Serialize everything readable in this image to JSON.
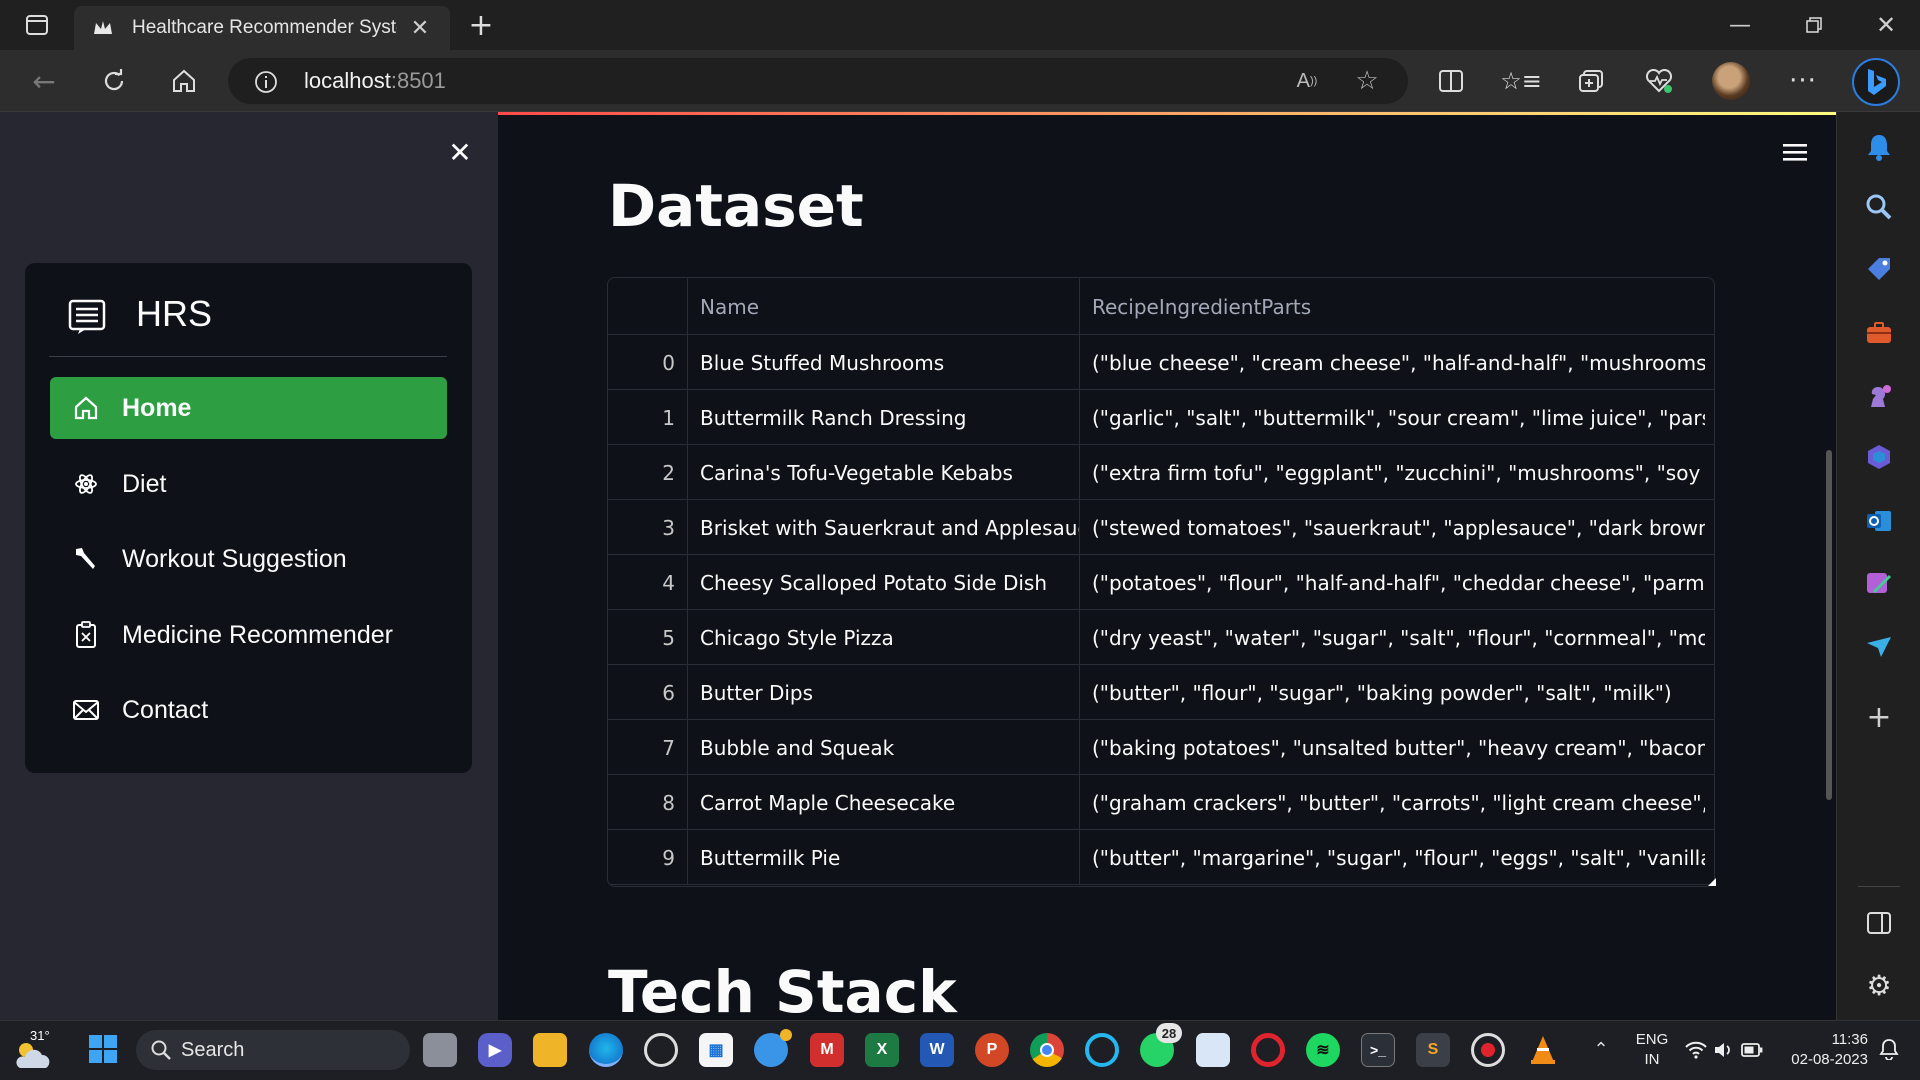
{
  "browser": {
    "tab_title": "Healthcare Recommender Systen",
    "url_host": "localhost",
    "url_port": ":8501"
  },
  "sidebar": {
    "brand": "HRS",
    "items": [
      {
        "label": "Home",
        "icon": "house-icon",
        "active": true
      },
      {
        "label": "Diet",
        "icon": "atom-icon",
        "active": false
      },
      {
        "label": "Workout Suggestion",
        "icon": "wrench-icon",
        "active": false
      },
      {
        "label": "Medicine Recommender",
        "icon": "clipboard-icon",
        "active": false
      },
      {
        "label": "Contact",
        "icon": "envelope-icon",
        "active": false
      }
    ]
  },
  "main": {
    "heading": "Dataset",
    "next_heading": "Tech Stack",
    "table": {
      "columns": [
        "",
        "Name",
        "RecipeIngredientParts"
      ],
      "rows": [
        [
          "0",
          "Blue Stuffed Mushrooms",
          "(\"blue cheese\", \"cream cheese\", \"half-and-half\", \"mushrooms\", \"pec"
        ],
        [
          "1",
          "Buttermilk Ranch Dressing",
          "(\"garlic\", \"salt\", \"buttermilk\", \"sour cream\", \"lime juice\", \"parsley\", \"("
        ],
        [
          "2",
          "Carina's Tofu-Vegetable Kebabs",
          "(\"extra firm tofu\", \"eggplant\", \"zucchini\", \"mushrooms\", \"soy sauce\","
        ],
        [
          "3",
          "Brisket with Sauerkraut and Applesauce",
          "(\"stewed tomatoes\", \"sauerkraut\", \"applesauce\", \"dark brown sugar"
        ],
        [
          "4",
          "Cheesy Scalloped Potato Side Dish",
          "(\"potatoes\", \"flour\", \"half-and-half\", \"cheddar cheese\", \"parmesan c"
        ],
        [
          "5",
          "Chicago Style Pizza",
          "(\"dry yeast\", \"water\", \"sugar\", \"salt\", \"flour\", \"cornmeal\", \"mozzarell"
        ],
        [
          "6",
          "Butter Dips",
          "(\"butter\", \"flour\", \"sugar\", \"baking powder\", \"salt\", \"milk\")"
        ],
        [
          "7",
          "Bubble and Squeak",
          "(\"baking potatoes\", \"unsalted butter\", \"heavy cream\", \"bacon\", \"oni"
        ],
        [
          "8",
          "Carrot Maple Cheesecake",
          "(\"graham crackers\", \"butter\", \"carrots\", \"light cream cheese\", \"granu"
        ],
        [
          "9",
          "Buttermilk Pie",
          "(\"butter\", \"margarine\", \"sugar\", \"flour\", \"eggs\", \"salt\", \"vanilla\", \"but"
        ]
      ]
    }
  },
  "taskbar": {
    "weather_temp": "31°",
    "search_label": "Search",
    "whatsapp_badge": "28",
    "lang": "ENG",
    "region": "IN",
    "time": "11:36",
    "date": "02-08-2023"
  },
  "colors": {
    "accent_green": "#2e9e43",
    "app_bg": "#0e1117",
    "sidebar_bg": "#262730"
  }
}
